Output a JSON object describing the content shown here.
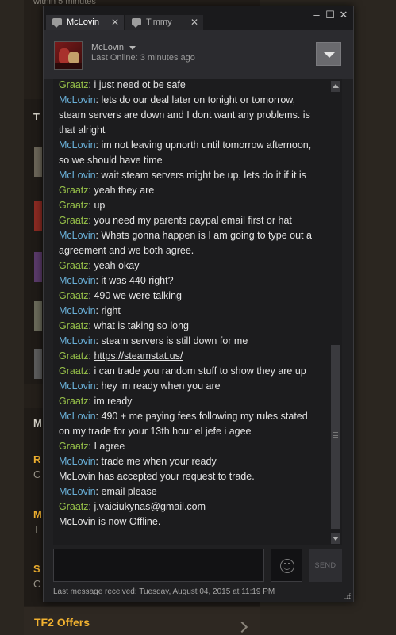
{
  "background": {
    "top_text": "within 5 minutes",
    "left_letters": [
      "T",
      "M",
      "R",
      "C",
      "M",
      "T",
      "S",
      "C"
    ],
    "bottom_link": "TF2 Offers"
  },
  "chat": {
    "tabs": [
      {
        "label": "McLovin",
        "active": true
      },
      {
        "label": "Timmy",
        "active": false
      }
    ],
    "window_controls": [
      "minimize",
      "maximize",
      "close"
    ],
    "friend": {
      "name": "McLovin",
      "status": "Last Online: 3 minutes ago"
    },
    "messages": [
      {
        "sender": "Graatz",
        "text": "i just need ot be safe"
      },
      {
        "sender": "McLovin",
        "text": "lets do our deal later on tonight or tomorrow, steam servers are down and I dont want any problems. is that alright"
      },
      {
        "sender": "McLovin",
        "text": "im not leaving upnorth until tomorrow afternoon, so we should have time"
      },
      {
        "sender": "McLovin",
        "text": "wait steam servers might be up, lets do it if it is"
      },
      {
        "sender": "Graatz",
        "text": "yeah they are"
      },
      {
        "sender": "Graatz",
        "text": "up"
      },
      {
        "sender": "Graatz",
        "text": "you need my parents paypal email first or hat"
      },
      {
        "sender": "McLovin",
        "text": "Whats gonna happen is I am going to type out a agreement and we both agree."
      },
      {
        "sender": "Graatz",
        "text": "yeah okay"
      },
      {
        "sender": "McLovin",
        "text": "it was 440 right?"
      },
      {
        "sender": "Graatz",
        "text": "490 we were talking"
      },
      {
        "sender": "McLovin",
        "text": "right"
      },
      {
        "sender": "Graatz",
        "text": "what is taking so long"
      },
      {
        "sender": "McLovin",
        "text": "steam servers is still down for me"
      },
      {
        "sender": "Graatz",
        "text": "https://steamstat.us/",
        "link": true
      },
      {
        "sender": "Graatz",
        "text": "i can trade you random stuff to show they are up"
      },
      {
        "sender": "McLovin",
        "text": "hey im ready when you are"
      },
      {
        "sender": "Graatz",
        "text": "im ready"
      },
      {
        "sender": "McLovin",
        "text": "490 + me paying fees following my rules stated on my trade for your 13th hour el jefe i agee"
      },
      {
        "sender": "Graatz",
        "text": "I agree"
      },
      {
        "sender": "McLovin",
        "text": "trade me when your ready"
      },
      {
        "sender": "",
        "text": "McLovin has accepted your request to trade."
      },
      {
        "sender": "McLovin",
        "text": "email please"
      },
      {
        "sender": "Graatz",
        "text": "j.vaiciukynas@gmail.com"
      },
      {
        "sender": "",
        "text": "McLovin is now Offline."
      }
    ],
    "send_label": "SEND",
    "last_received": "Last message received: Tuesday, August 04, 2015 at 11:19 PM"
  },
  "colors": {
    "mclovin": "#6ab0d8",
    "graatz": "#9ac54a",
    "bg_accent": "#f2b230"
  }
}
